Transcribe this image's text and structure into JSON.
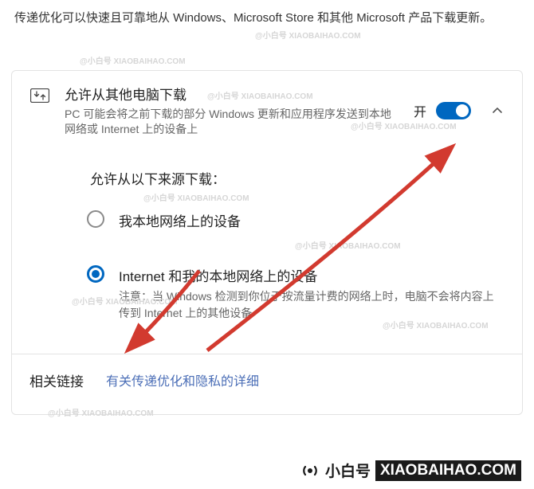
{
  "header": {
    "description": "传递优化可以快速且可靠地从 Windows、Microsoft Store 和其他 Microsoft 产品下载更新。"
  },
  "setting": {
    "title": "允许从其他电脑下载",
    "subtitle": "PC 可能会将之前下载的部分 Windows 更新和应用程序发送到本地网络或 Internet 上的设备上",
    "toggle_label": "开",
    "toggle_state": "on"
  },
  "radio_section": {
    "heading": "允许从以下来源下载：",
    "options": [
      {
        "label": "我本地网络上的设备",
        "note": "",
        "selected": false
      },
      {
        "label": "Internet 和我的本地网络上的设备",
        "note": "注意：当 Windows 检测到你位于按流量计费的网络上时，电脑不会将内容上传到 Internet 上的其他设备",
        "selected": true
      }
    ]
  },
  "related": {
    "label": "相关链接",
    "link": "有关传递优化和隐私的详细"
  },
  "watermark": {
    "brand_cn": "小白号",
    "brand_en": "XIAOBAIHAO.COM",
    "combined": "@小白号 XIAOBAIHAO.COM"
  },
  "annotations": {
    "arrow_color": "#d23a2f"
  }
}
